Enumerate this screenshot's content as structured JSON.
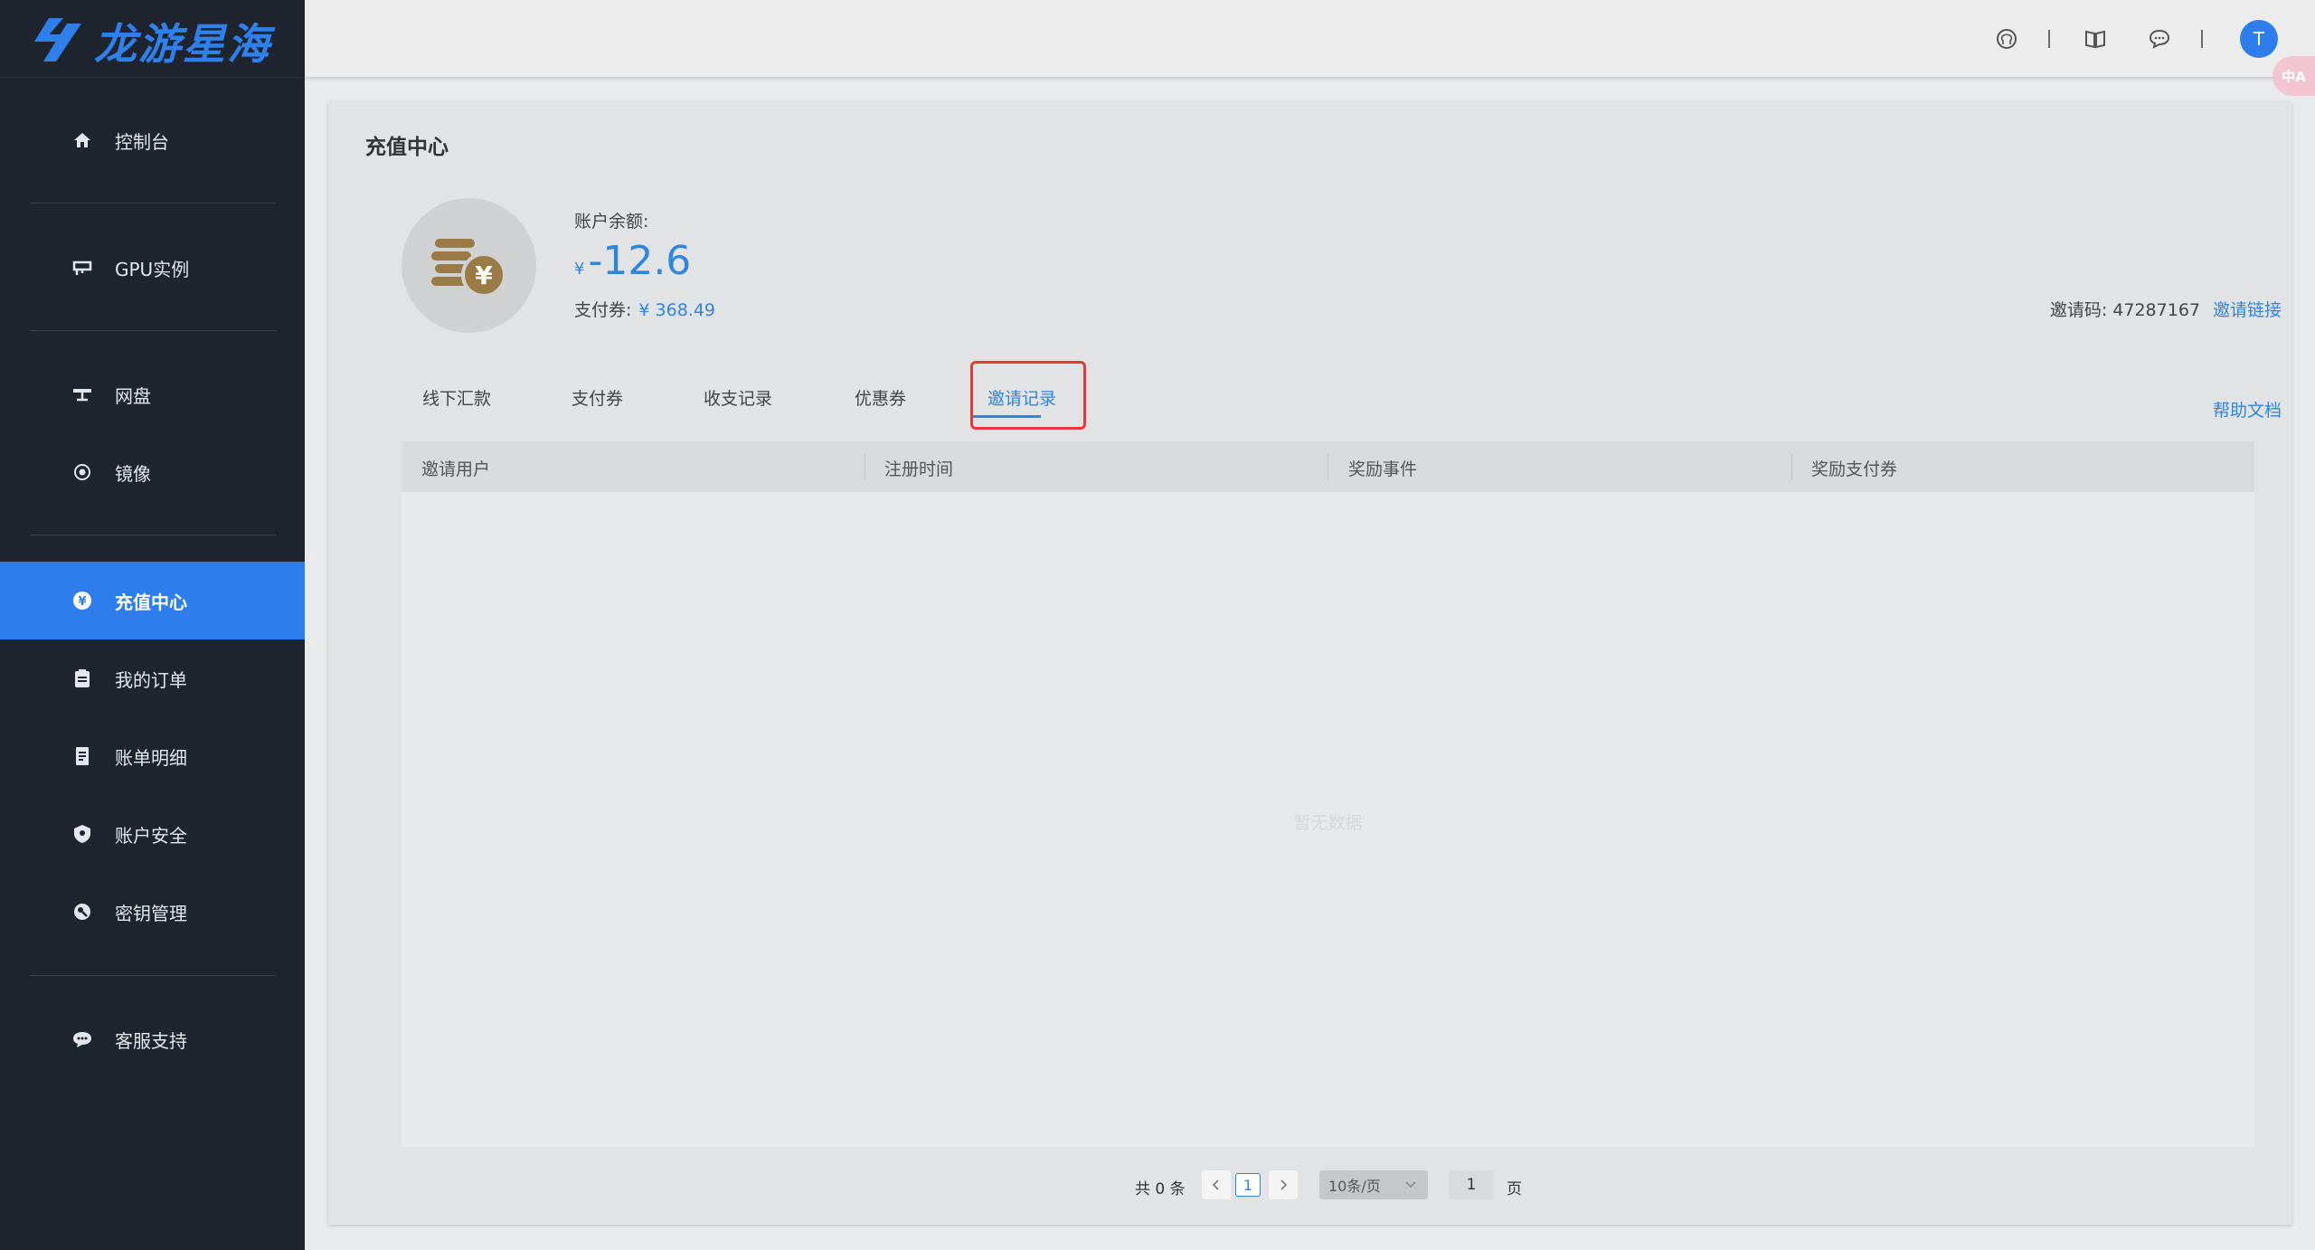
{
  "brand": {
    "name": "龙游星海"
  },
  "sidebar": {
    "items": [
      {
        "label": "控制台",
        "icon": "home-icon"
      },
      {
        "label": "GPU实例",
        "icon": "gpu-icon"
      },
      {
        "label": "网盘",
        "icon": "network-disk-icon"
      },
      {
        "label": "镜像",
        "icon": "image-disc-icon"
      },
      {
        "label": "充值中心",
        "icon": "yen-circle-icon",
        "active": true
      },
      {
        "label": "我的订单",
        "icon": "clipboard-icon"
      },
      {
        "label": "账单明细",
        "icon": "bill-icon"
      },
      {
        "label": "账户安全",
        "icon": "shield-icon"
      },
      {
        "label": "密钥管理",
        "icon": "key-icon"
      },
      {
        "label": "客服支持",
        "icon": "chat-icon"
      }
    ]
  },
  "topbar": {
    "icons": [
      "github-icon",
      "book-icon",
      "message-icon"
    ],
    "avatar_initial": "T",
    "translate_label": "中A"
  },
  "page": {
    "title": "充值中心",
    "balance_label": "账户余额:",
    "currency_symbol": "¥",
    "balance": "-12.6",
    "voucher_label": "支付券:",
    "voucher_value": "¥ 368.49",
    "invite_code_label": "邀请码: 47287167",
    "invite_link_label": "邀请链接",
    "help_doc_label": "帮助文档"
  },
  "tabs": [
    {
      "label": "线下汇款"
    },
    {
      "label": "支付券"
    },
    {
      "label": "收支记录"
    },
    {
      "label": "优惠券"
    },
    {
      "label": "邀请记录",
      "active": true
    }
  ],
  "table": {
    "columns": [
      "邀请用户",
      "注册时间",
      "奖励事件",
      "奖励支付券"
    ],
    "rows": [],
    "empty_text": "暂无数据"
  },
  "pagination": {
    "total_label": "共 0 条",
    "current_page": "1",
    "page_size": "10条/页",
    "goto_value": "1",
    "goto_unit": "页"
  },
  "colors": {
    "accent": "#2e86de",
    "sidebar_bg": "#1f252e",
    "active_nav": "#2e7ded",
    "highlight": "#e53838",
    "coin": "#9a7a45"
  }
}
